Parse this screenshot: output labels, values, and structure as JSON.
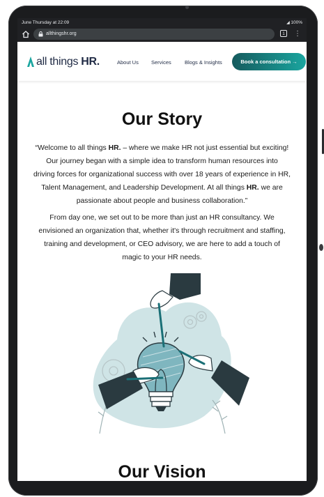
{
  "status": {
    "time": "June Thursday at 22:09",
    "battery": "100%"
  },
  "browser": {
    "url": "allthingshr.org",
    "tab_count": "1"
  },
  "header": {
    "logo_text_prefix": "all things ",
    "logo_text_brand": "HR.",
    "nav": [
      {
        "label": "About Us"
      },
      {
        "label": "Services"
      },
      {
        "label": "Blogs & Insights"
      }
    ],
    "cta_label": "Book a consultation →"
  },
  "story": {
    "title": "Our Story",
    "p1_lines": [
      "“Welcome to all things HR. – where we make HR not just essential but exciting!",
      "Our journey began with a simple idea to transform human resources into",
      "driving forces for organizational success with over 18 years of experience in HR,",
      "Talent Management, and Leadership Development. At all things HR. we are",
      "passionate about people and business collaboration.”"
    ],
    "p2_lines": [
      "From day one, we set out to be more than just an HR consultancy. We",
      "envisioned an organization that, whether it's through recruitment and staffing,",
      "training and development, or CEO advisory, we are here to add a touch of",
      "magic to your HR needs."
    ]
  },
  "vision": {
    "title": "Our Vision"
  },
  "colors": {
    "brand_teal": "#1aa59f",
    "brand_dark": "#155b5e",
    "navy": "#1f2a44",
    "illustration_blob": "#cfe4e6"
  },
  "icons": [
    "home-icon",
    "lock-icon",
    "tabs-icon",
    "menu-icon",
    "battery-icon",
    "logo-mark-icon"
  ]
}
